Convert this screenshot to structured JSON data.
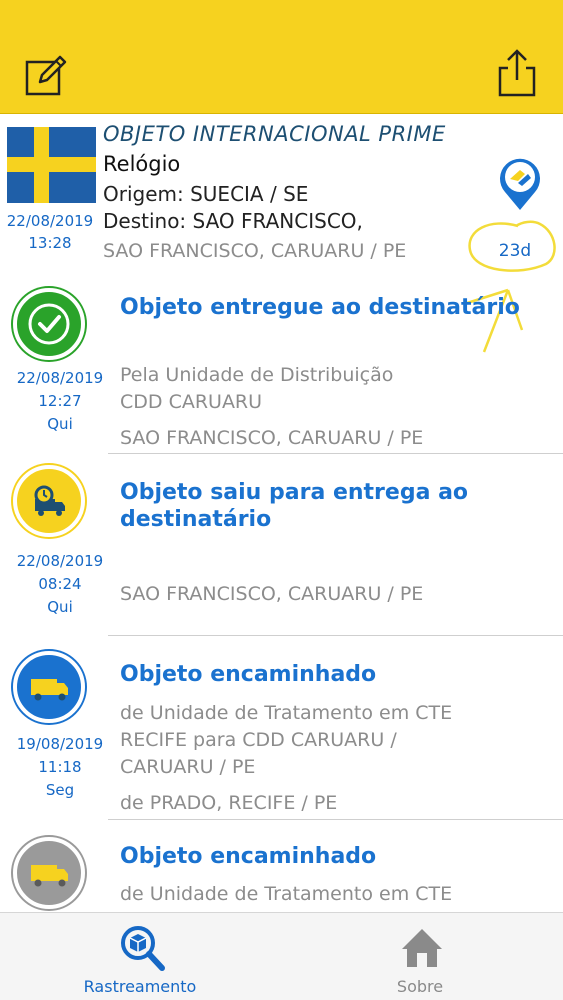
{
  "header": {
    "edit_icon": "edit-icon",
    "share_icon": "share-icon",
    "background": "#f6d21f"
  },
  "summary": {
    "service": "OBJETO INTERNACIONAL PRIME",
    "item": "Relógio",
    "origin": "Origem: SUECIA / SE",
    "destination": "Destino: SAO FRANCISCO,",
    "destination_city": "SAO FRANCISCO, CARUARU / PE",
    "date": "22/08/2019",
    "time": "13:28",
    "days": "23d",
    "flag": "sweden-flag",
    "map_pin_icon": "map-pin-icon"
  },
  "events": [
    {
      "title": "Objeto entregue ao destinatário",
      "date": "22/08/2019",
      "time": "12:27",
      "weekday": "Qui",
      "line1": "Pela Unidade de Distribuição",
      "line2": "CDD CARUARU",
      "line3": "",
      "location": "SAO FRANCISCO, CARUARU / PE",
      "icon": "check-icon",
      "color": "#2aa32a"
    },
    {
      "title": "Objeto saiu para entrega ao destinatário",
      "date": "22/08/2019",
      "time": "08:24",
      "weekday": "Qui",
      "line1": "",
      "line2": "",
      "line3": "",
      "location": "SAO FRANCISCO, CARUARU / PE",
      "icon": "delivery-truck-clock-icon",
      "color": "#f6d21f"
    },
    {
      "title": "Objeto encaminhado",
      "date": "19/08/2019",
      "time": "11:18",
      "weekday": "Seg",
      "line1": "de Unidade de Tratamento em CTE",
      "line2": "RECIFE para CDD CARUARU /",
      "line3": "CARUARU / PE",
      "location": "de PRADO, RECIFE / PE",
      "icon": "truck-icon",
      "color": "#1a72cf"
    },
    {
      "title": "Objeto encaminhado",
      "date": "",
      "time": "",
      "weekday": "",
      "line1": "de Unidade de Tratamento em CTE",
      "line2": "",
      "line3": "",
      "location": "",
      "icon": "truck-icon",
      "color": "#9a9a9a"
    }
  ],
  "tabbar": {
    "tabs": [
      {
        "label": "Rastreamento",
        "icon": "package-search-icon",
        "active": true
      },
      {
        "label": "Sobre",
        "icon": "house-icon",
        "active": false
      }
    ]
  }
}
